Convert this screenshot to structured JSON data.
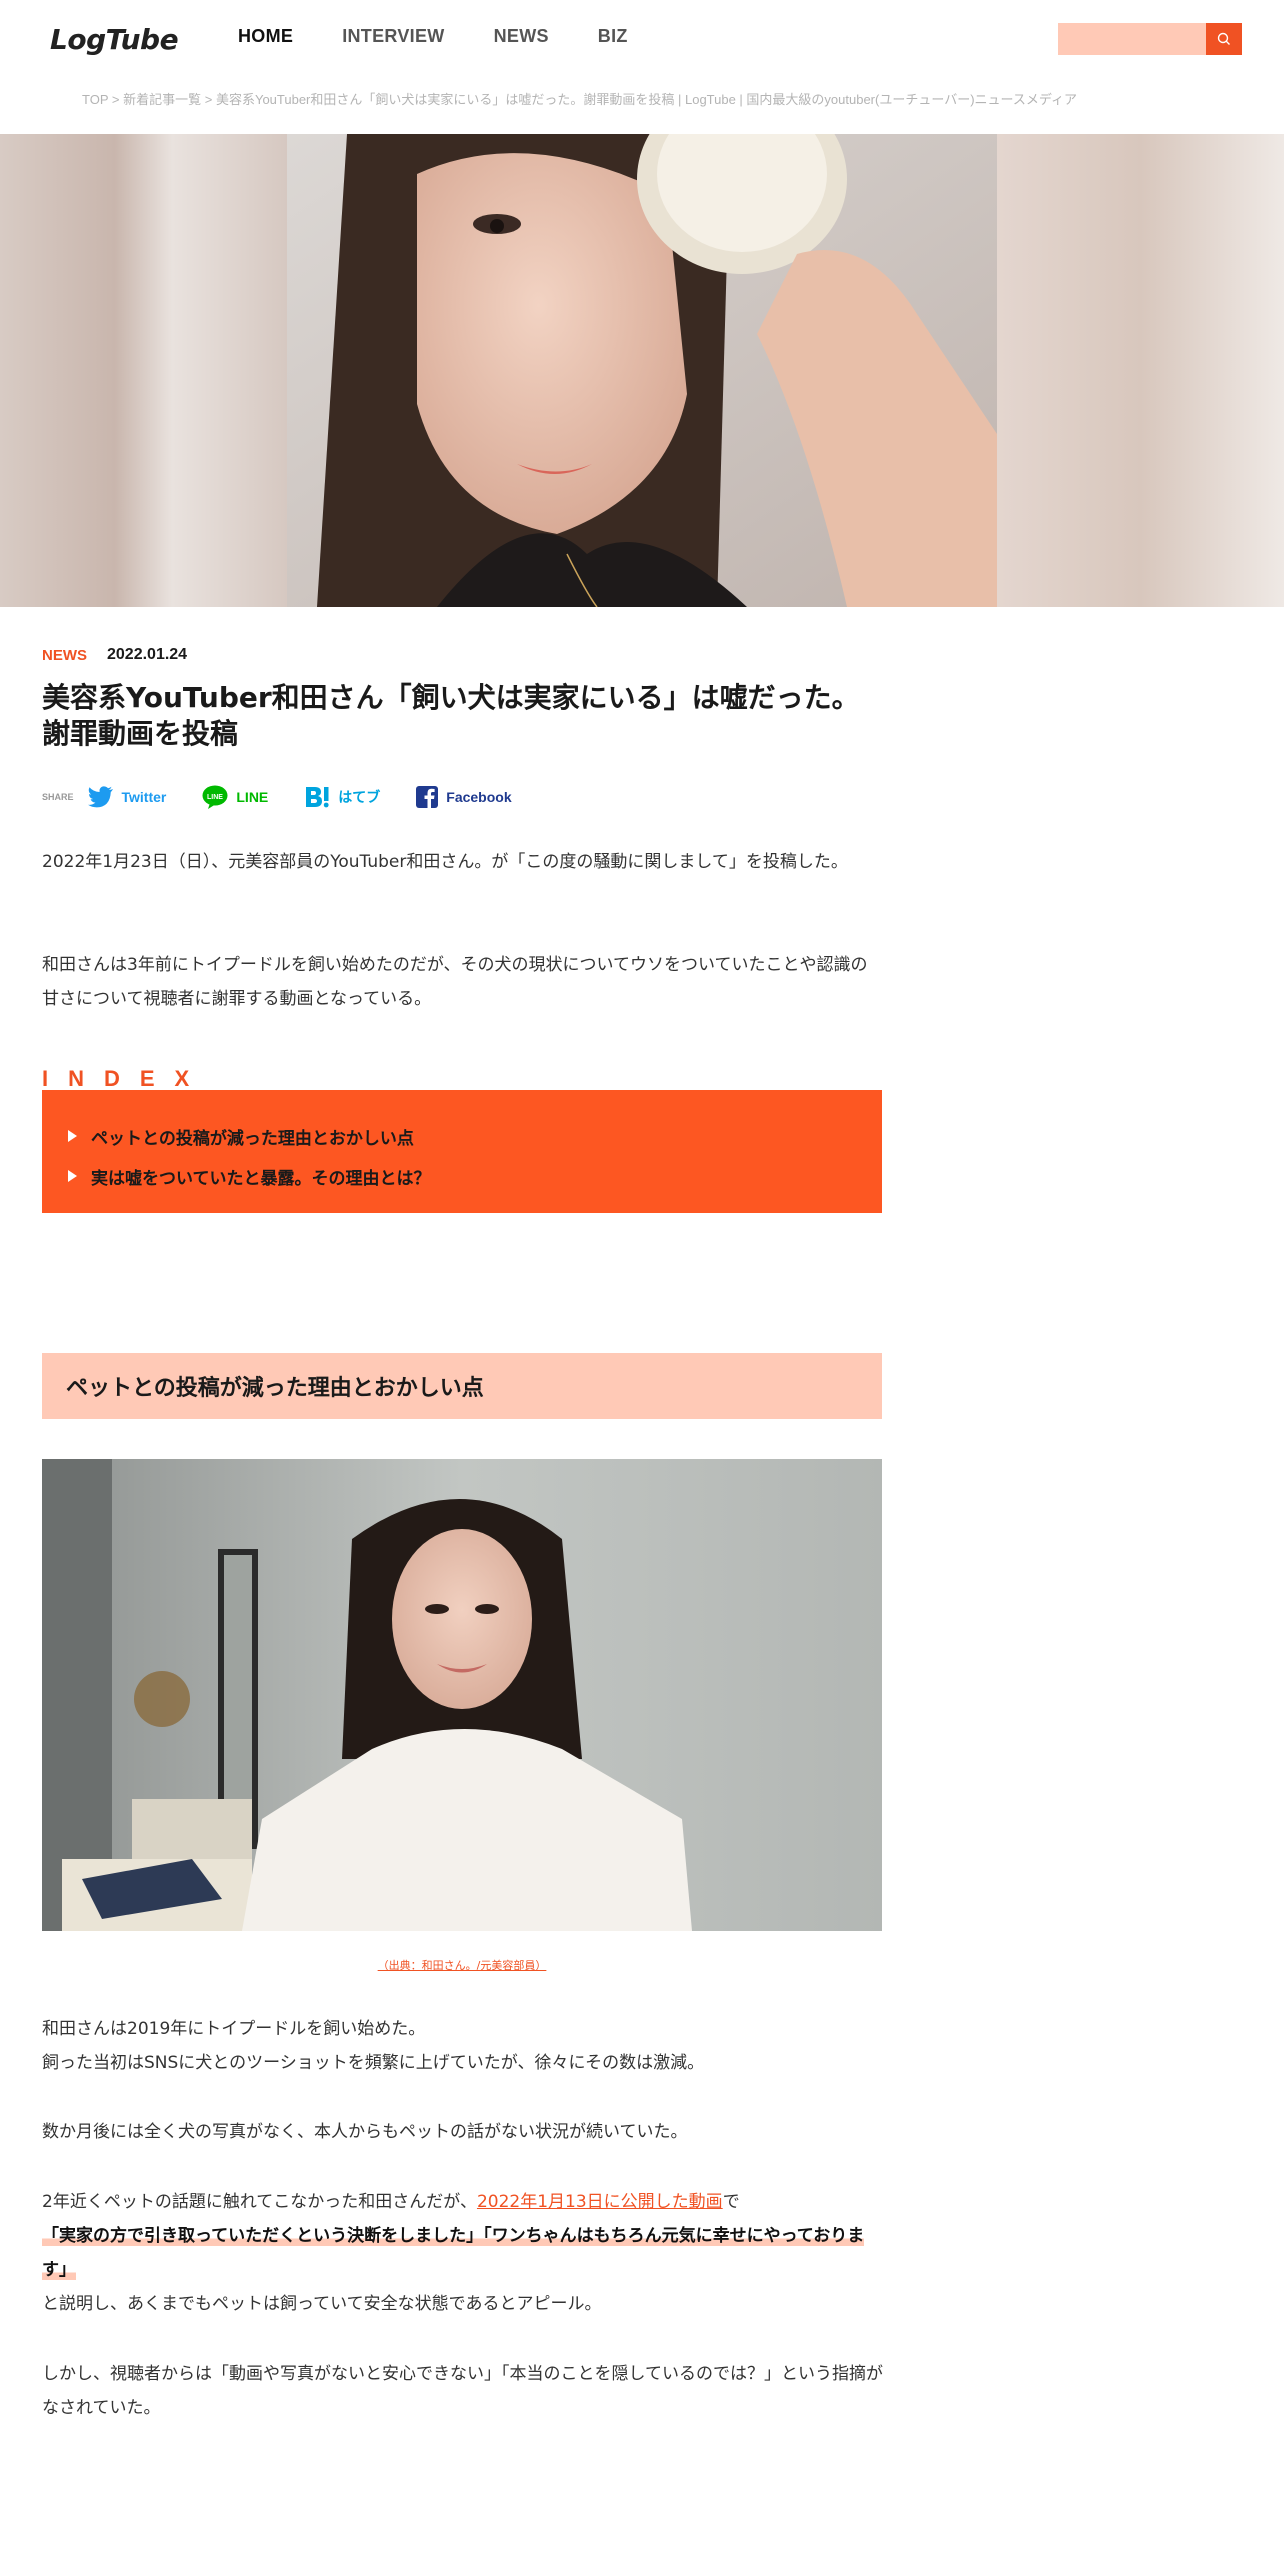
{
  "header": {
    "logo_text": "LogTube",
    "nav": [
      "HOME",
      "INTERVIEW",
      "NEWS",
      "BIZ"
    ],
    "search_placeholder": ""
  },
  "breadcrumb": {
    "items": [
      "TOP",
      "新着記事一覧",
      "美容系YouTuber和田さん「飼い犬は実家にいる」は嘘だった。謝罪動画を投稿 | LogTube | 国内最大級のyoutuber(ユーチューバー)ニュースメディア"
    ],
    "separator": ">"
  },
  "article": {
    "category": "NEWS",
    "date": "2022.01.24",
    "title": "美容系YouTuber和田さん「飼い犬は実家にいる」は嘘だった。謝罪動画を投稿",
    "share": {
      "label": "SHARE",
      "twitter": "Twitter",
      "line": "LINE",
      "hatena": "はてブ",
      "facebook": "Facebook"
    },
    "intro_1": "2022年1月23日（日）、元美容部員のYouTuber和田さん。が「この度の騒動に関しまして」を投稿した。",
    "intro_2": "和田さんは3年前にトイプードルを飼い始めたのだが、その犬の現状についてウソをついていたことや認識の甘さについて視聴者に謝罪する動画となっている。",
    "index": {
      "label": "INDEX",
      "items": [
        "ペットとの投稿が減った理由とおかしい点",
        "実は嘘をついていたと暴露。その理由とは？"
      ]
    },
    "section_1": {
      "heading": "ペットとの投稿が減った理由とおかしい点",
      "caption": "（出典：和田さん。/元美容部員）",
      "p1_line1": "和田さんは2019年にトイプードルを飼い始めた。",
      "p1_line2": "飼った当初はSNSに犬とのツーショットを頻繁に上げていたが、徐々にその数は激減。",
      "p2": "数か月後には全く犬の写真がなく、本人からもペットの話がない状況が続いていた。",
      "p3_prefix": "2年近くペットの話題に触れてこなかった和田さんだが、",
      "p3_link": "2022年1月13日に公開した動画",
      "p3_suffix": "で",
      "p3_quote": "「実家の方で引き取っていただくという決断をしました」「ワンちゃんはもちろん元気に幸せにやっております」",
      "p3_end": "と説明し、あくまでもペットは飼っていて安全な状態であるとアピール。",
      "p4": "しかし、視聴者からは「動画や写真がないと安心できない」「本当のことを隠しているのでは？」という指摘がなされていた。"
    }
  },
  "colors": {
    "accent": "#f05223",
    "accent_light": "#ffc9b6",
    "index_bg": "#fd5722"
  }
}
